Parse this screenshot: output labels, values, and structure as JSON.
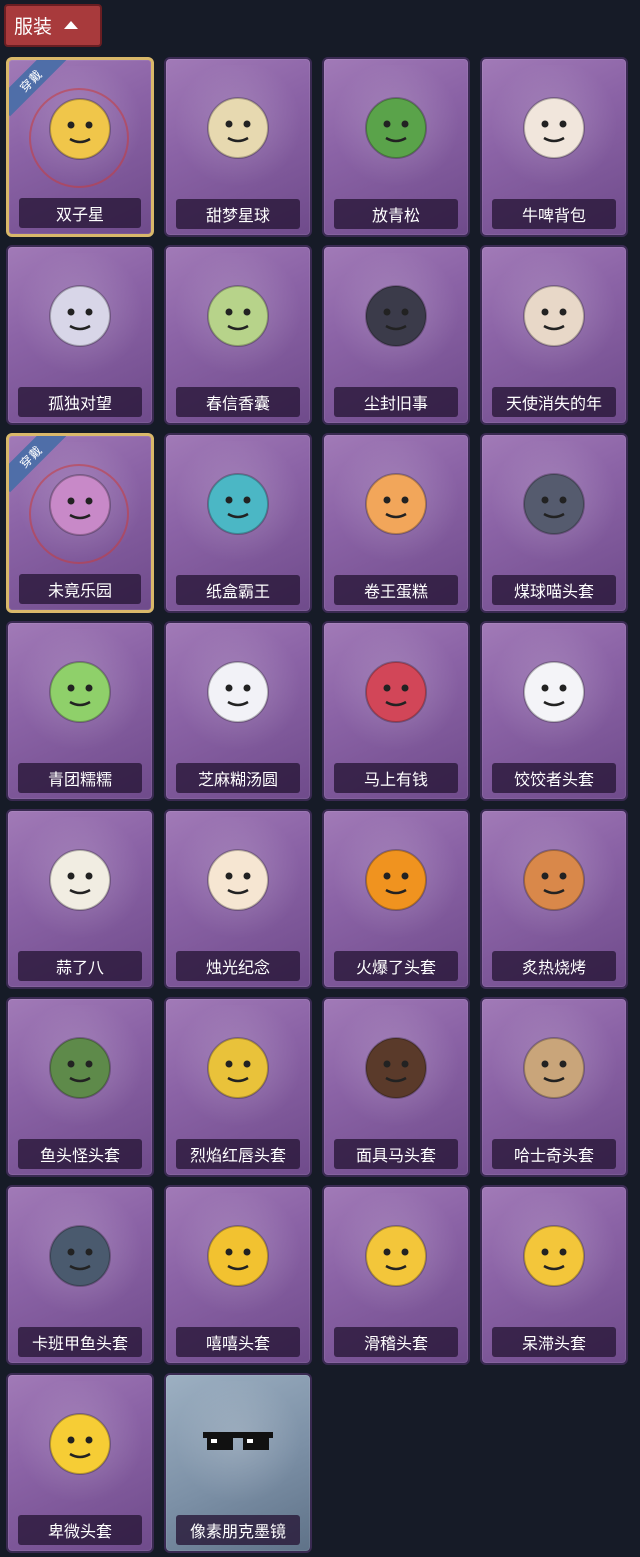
{
  "header": {
    "title": "服装"
  },
  "worn_badge": "穿戴",
  "items": [
    {
      "name": "双子星",
      "icon": "planet-doll-icon",
      "worn": true
    },
    {
      "name": "甜梦星球",
      "icon": "moon-cat-icon"
    },
    {
      "name": "放青松",
      "icon": "bonsai-pine-icon"
    },
    {
      "name": "牛啤背包",
      "icon": "cow-beer-barrel-icon"
    },
    {
      "name": "孤独对望",
      "icon": "silver-hair-keychain-icon"
    },
    {
      "name": "春信香囊",
      "icon": "green-sachet-icon"
    },
    {
      "name": "尘封旧事",
      "icon": "dark-hair-keychain-icon"
    },
    {
      "name": "天使消失的年",
      "icon": "angel-keychain-icon"
    },
    {
      "name": "未竟乐园",
      "icon": "pink-hair-doll-icon",
      "worn": true
    },
    {
      "name": "纸盒霸王",
      "icon": "box-dinosaur-icon"
    },
    {
      "name": "卷王蛋糕",
      "icon": "swiss-roll-icon"
    },
    {
      "name": "煤球喵头套",
      "icon": "black-cat-head-icon"
    },
    {
      "name": "青团糯糯",
      "icon": "green-mochi-icon"
    },
    {
      "name": "芝麻糊汤圆",
      "icon": "white-dumpling-icon"
    },
    {
      "name": "马上有钱",
      "icon": "red-horse-icon"
    },
    {
      "name": "饺饺者头套",
      "icon": "dumpling-head-icon"
    },
    {
      "name": "蒜了八",
      "icon": "garlic-icon"
    },
    {
      "name": "烛光纪念",
      "icon": "candle-icon"
    },
    {
      "name": "火爆了头套",
      "icon": "fire-head-icon"
    },
    {
      "name": "炙热烧烤",
      "icon": "bbq-meat-icon"
    },
    {
      "name": "鱼头怪头套",
      "icon": "fish-mask-icon"
    },
    {
      "name": "烈焰红唇头套",
      "icon": "yellow-mouse-mask-icon"
    },
    {
      "name": "面具马头套",
      "icon": "horse-mask-icon"
    },
    {
      "name": "哈士奇头套",
      "icon": "husky-mask-icon"
    },
    {
      "name": "卡班甲鱼头套",
      "icon": "whale-head-icon"
    },
    {
      "name": "嘻嘻头套",
      "icon": "grin-emoji-icon"
    },
    {
      "name": "滑稽头套",
      "icon": "smirk-emoji-icon"
    },
    {
      "name": "呆滞头套",
      "icon": "dazed-emoji-icon"
    },
    {
      "name": "卑微头套",
      "icon": "humble-emoji-icon"
    },
    {
      "name": "像素朋克墨镜",
      "icon": "pixel-sunglasses-icon",
      "grey": true
    }
  ],
  "colors": {
    "background": "#161b27",
    "card_purple": "#8b63a6",
    "card_grey": "#7c90a6",
    "worn_border": "#d9b86a",
    "header_red": "#a83a3c"
  }
}
